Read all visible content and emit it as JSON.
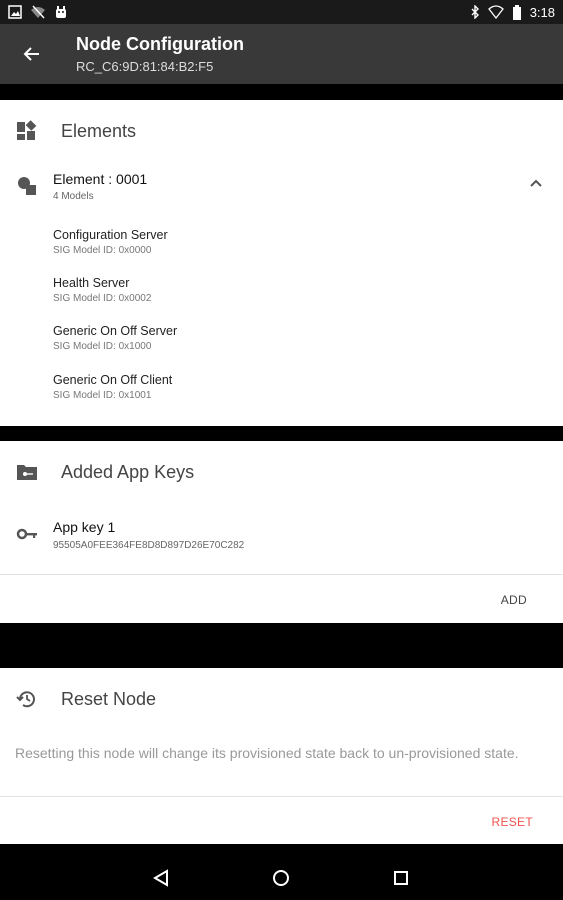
{
  "status_bar": {
    "time": "3:18"
  },
  "app_bar": {
    "title": "Node Configuration",
    "subtitle": "RC_C6:9D:81:84:B2:F5"
  },
  "elements_card": {
    "title": "Elements",
    "element": {
      "title": "Element : 0001",
      "subtitle": "4 Models"
    },
    "models": [
      {
        "name": "Configuration Server",
        "id": "SIG Model ID: 0x0000"
      },
      {
        "name": "Health Server",
        "id": "SIG Model ID: 0x0002"
      },
      {
        "name": "Generic On Off Server",
        "id": "SIG Model ID: 0x1000"
      },
      {
        "name": "Generic On Off Client",
        "id": "SIG Model ID: 0x1001"
      }
    ]
  },
  "app_keys_card": {
    "title": "Added App Keys",
    "key": {
      "name": "App key 1",
      "value": "95505A0FEE364FE8D8D897D26E70C282"
    },
    "add_label": "ADD"
  },
  "reset_card": {
    "title": "Reset Node",
    "description": "Resetting this node will change its provisioned state back to un-provisioned state.",
    "reset_label": "RESET"
  },
  "colors": {
    "app_bar": "#393939",
    "reset_red": "#f0524f",
    "card_bg": "#ffffff"
  },
  "icons": {
    "status_left": [
      "image-icon",
      "wifi-off-icon",
      "android-icon"
    ],
    "status_right": [
      "bluetooth-icon",
      "wifi-icon",
      "battery-icon"
    ],
    "nav": [
      "back-triangle-icon",
      "home-circle-icon",
      "recents-square-icon"
    ]
  }
}
